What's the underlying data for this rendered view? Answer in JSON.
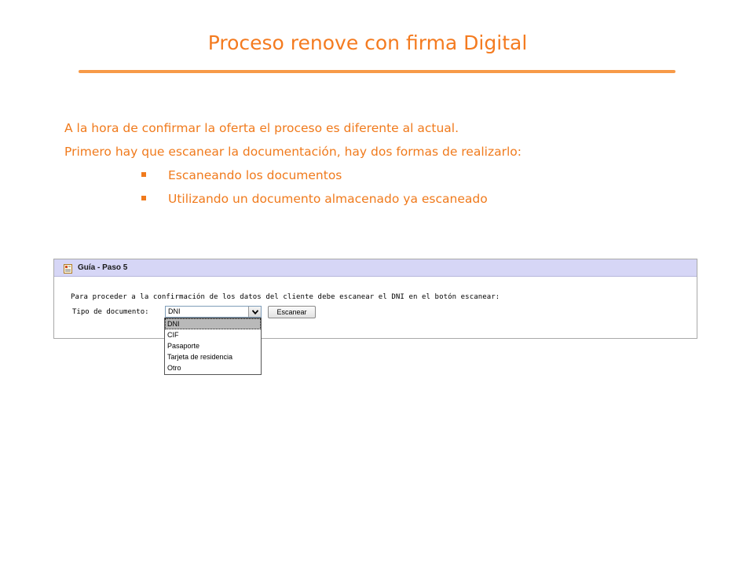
{
  "slide": {
    "title": "Proceso renove con firma Digital",
    "paragraphs": [
      "A la hora de confirmar la oferta el proceso es diferente al actual.",
      "Primero hay que escanear la documentación, hay dos formas de realizarlo:"
    ],
    "bullets": [
      "Escaneando los documentos",
      "Utilizando un documento almacenado ya escaneado"
    ]
  },
  "panel": {
    "title": "Guía - Paso 5",
    "instruction": "Para proceder a la confirmación de los datos del cliente debe escanear el DNI en el botón escanear:",
    "doc_type_label": "Tipo de documento:",
    "select_value": "DNI",
    "scan_button_label": "Escanear",
    "options": [
      "DNI",
      "CIF",
      "Pasaporte",
      "Tarjeta de residencia",
      "Otro"
    ],
    "selected_option": "DNI"
  },
  "colors": {
    "accent": "#f47b20",
    "underline": "#f79a48",
    "panel_header": "#d6d6f6"
  },
  "icons": {
    "panel_icon": "document-icon",
    "bullet": "square-bullet-icon",
    "select_arrow": "chevron-down-icon"
  }
}
